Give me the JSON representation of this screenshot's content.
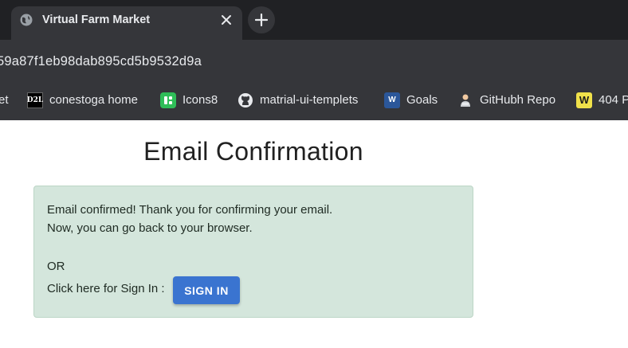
{
  "browser": {
    "tab_title": "Virtual Farm Market",
    "url": "59a87f1eb98dab895cd5b9532d9a",
    "bookmarks": [
      {
        "label": "et",
        "icon": "none"
      },
      {
        "label": "conestoga home",
        "icon": "d2l-icon",
        "icon_text": "D2L"
      },
      {
        "label": "Icons8",
        "icon": "icons8-icon"
      },
      {
        "label": "matrial-ui-templets",
        "icon": "github-icon"
      },
      {
        "label": "Goals",
        "icon": "word-icon",
        "icon_text": "W"
      },
      {
        "label": "GitHubh Repo",
        "icon": "person-icon"
      },
      {
        "label": "404 P",
        "icon": "w404-icon",
        "icon_text": "W"
      }
    ]
  },
  "page": {
    "title": "Email Confirmation",
    "alert": {
      "line1": "Email confirmed! Thank you for confirming your email.",
      "line2": "Now, you can go back to your browser.",
      "or_text": "OR",
      "signin_prompt": "Click here for Sign In :",
      "signin_button": "SIGN IN"
    }
  },
  "colors": {
    "alert_bg": "#d4e6dc",
    "button_bg": "#3a74d0",
    "chrome_dark": "#202124",
    "chrome_toolbar": "#35363a"
  }
}
